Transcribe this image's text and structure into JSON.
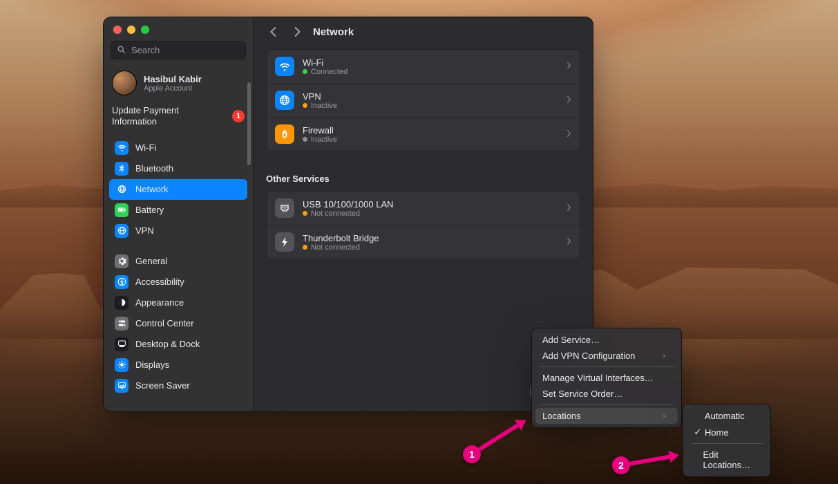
{
  "header": {
    "title": "Network"
  },
  "search": {
    "placeholder": "Search"
  },
  "account": {
    "name": "Hasibul Kabir",
    "subtitle": "Apple Account"
  },
  "update_notice": {
    "text": "Update Payment Information",
    "badge": "1"
  },
  "sidebar": {
    "items": [
      {
        "label": "Wi-Fi",
        "icon": "wifi-icon",
        "tint": "blue"
      },
      {
        "label": "Bluetooth",
        "icon": "bluetooth-icon",
        "tint": "blue"
      },
      {
        "label": "Network",
        "icon": "globe-icon",
        "tint": "blue",
        "selected": true
      },
      {
        "label": "Battery",
        "icon": "battery-icon",
        "tint": "green"
      },
      {
        "label": "VPN",
        "icon": "vpn-icon",
        "tint": "blue"
      },
      {
        "label": "General",
        "icon": "gear-icon",
        "tint": "grey"
      },
      {
        "label": "Accessibility",
        "icon": "accessibility-icon",
        "tint": "blue"
      },
      {
        "label": "Appearance",
        "icon": "appearance-icon",
        "tint": "black"
      },
      {
        "label": "Control Center",
        "icon": "switches-icon",
        "tint": "grey"
      },
      {
        "label": "Desktop & Dock",
        "icon": "dock-icon",
        "tint": "black"
      },
      {
        "label": "Displays",
        "icon": "displays-icon",
        "tint": "blue"
      },
      {
        "label": "Screen Saver",
        "icon": "screensaver-icon",
        "tint": "blue"
      }
    ]
  },
  "services": {
    "primary": [
      {
        "name": "Wi-Fi",
        "status": "Connected",
        "dot": "green",
        "icon": "wifi-icon",
        "tint": "blue"
      },
      {
        "name": "VPN",
        "status": "Inactive",
        "dot": "orange",
        "icon": "globe-icon",
        "tint": "blue"
      },
      {
        "name": "Firewall",
        "status": "Inactive",
        "dot": "grey",
        "icon": "firewall-icon",
        "tint": "orange"
      }
    ],
    "other_label": "Other Services",
    "other": [
      {
        "name": "USB 10/100/1000 LAN",
        "status": "Not connected",
        "dot": "orange",
        "icon": "ethernet-icon",
        "tint": "grey"
      },
      {
        "name": "Thunderbolt Bridge",
        "status": "Not connected",
        "dot": "orange",
        "icon": "thunderbolt-icon",
        "tint": "grey"
      }
    ]
  },
  "action_menu": {
    "items": [
      {
        "label": "Add Service…"
      },
      {
        "label": "Add VPN Configuration",
        "submenu": true
      },
      {
        "sep": true
      },
      {
        "label": "Manage Virtual Interfaces…"
      },
      {
        "label": "Set Service Order…"
      },
      {
        "sep": true
      },
      {
        "label": "Locations",
        "submenu": true,
        "highlight": true
      }
    ]
  },
  "locations_submenu": {
    "items": [
      {
        "label": "Automatic"
      },
      {
        "label": "Home",
        "checked": true
      },
      {
        "sep": true
      },
      {
        "label": "Edit Locations…"
      }
    ]
  },
  "annotations": {
    "a1": "1",
    "a2": "2"
  }
}
